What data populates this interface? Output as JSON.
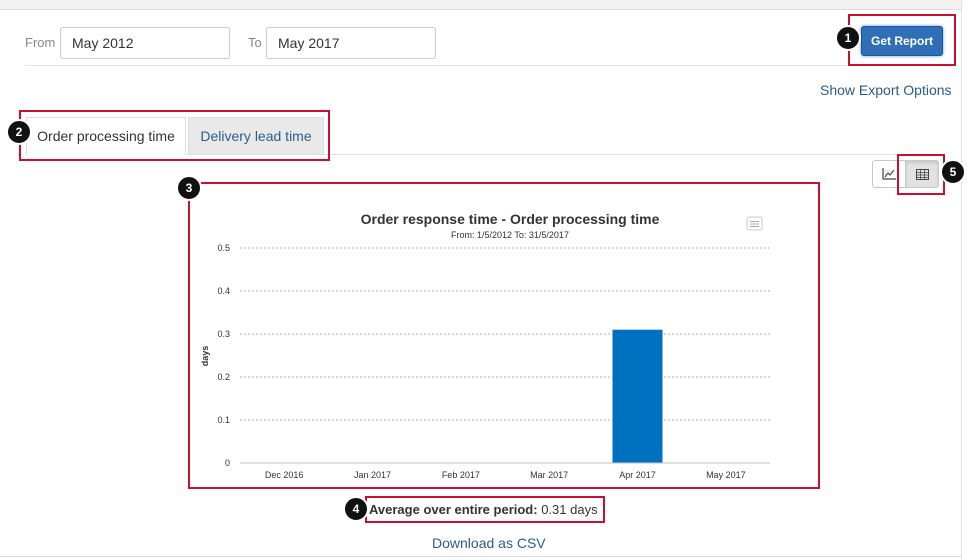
{
  "filters": {
    "from_label": "From",
    "from_value": "May 2012",
    "to_label": "To",
    "to_value": "May 2017",
    "get_report_label": "Get Report"
  },
  "export_options_label": "Show Export Options",
  "tabs": [
    {
      "label": "Order processing time",
      "active": true
    },
    {
      "label": "Delivery lead time",
      "active": false
    }
  ],
  "view_toggle": {
    "chart_icon": "chart-icon",
    "table_icon": "table-icon",
    "selected": "table"
  },
  "chart_data": {
    "type": "bar",
    "title": "Order response time - Order processing time",
    "subtitle": "From: 1/5/2012 To: 31/5/2017",
    "ylabel": "days",
    "xlabel": "",
    "categories": [
      "Dec 2016",
      "Jan 2017",
      "Feb 2017",
      "Mar 2017",
      "Apr 2017",
      "May 2017"
    ],
    "values": [
      0,
      0,
      0,
      0,
      0.31,
      0
    ],
    "ylim": [
      0,
      0.5
    ],
    "yticks": [
      "0",
      "0.1",
      "0.2",
      "0.3",
      "0.4",
      "0.5"
    ],
    "grid": true,
    "bar_color": "#0071c1",
    "menu_icon": "context-menu-icon"
  },
  "summary": {
    "label": "Average over entire period:",
    "value": "0.31 days"
  },
  "download_csv_label": "Download as CSV",
  "annotations": [
    "1",
    "2",
    "3",
    "4",
    "5"
  ],
  "colors": {
    "accent": "#2f6fb7",
    "link": "#2a5d8f",
    "highlight": "#c8102e"
  }
}
